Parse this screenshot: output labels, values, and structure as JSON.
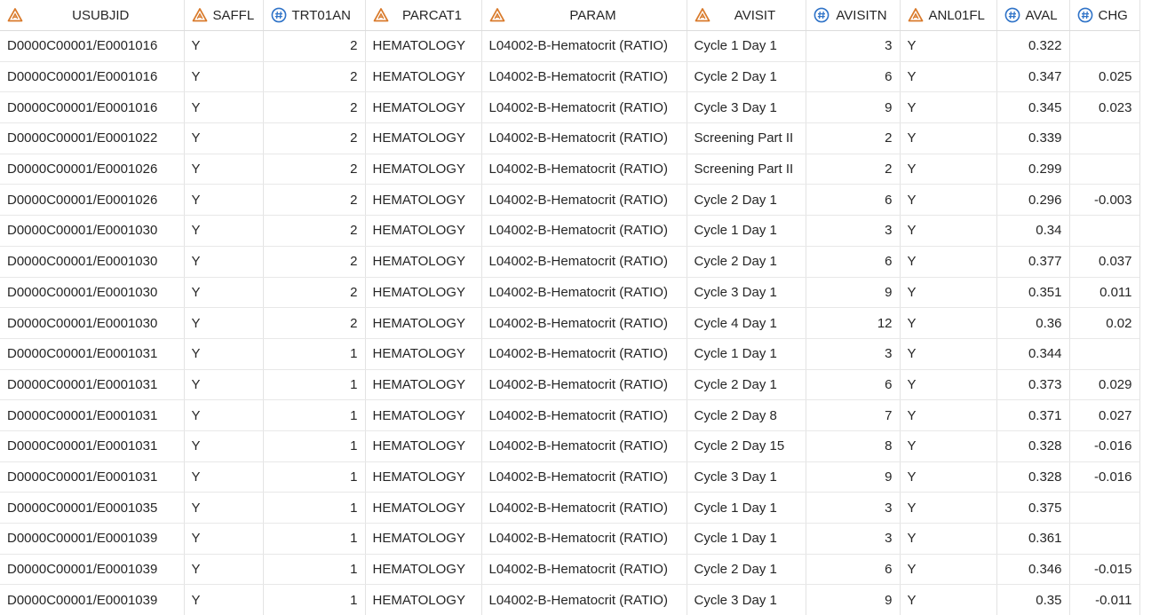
{
  "columns": [
    {
      "name": "USUBJID",
      "type": "char"
    },
    {
      "name": "SAFFL",
      "type": "char"
    },
    {
      "name": "TRT01AN",
      "type": "num"
    },
    {
      "name": "PARCAT1",
      "type": "char"
    },
    {
      "name": "PARAM",
      "type": "char"
    },
    {
      "name": "AVISIT",
      "type": "char"
    },
    {
      "name": "AVISITN",
      "type": "num"
    },
    {
      "name": "ANL01FL",
      "type": "char"
    },
    {
      "name": "AVAL",
      "type": "num"
    },
    {
      "name": "CHG",
      "type": "num"
    }
  ],
  "icons": {
    "char": "character-column-icon",
    "num": "numeric-column-icon"
  },
  "colors": {
    "char_icon": "#d97a2b",
    "num_icon": "#2f73c8",
    "grid_line": "#e3e3e3"
  },
  "rows": [
    [
      "D0000C00001/E0001016",
      "Y",
      "2",
      "HEMATOLOGY",
      "L04002-B-Hematocrit (RATIO)",
      "Cycle 1 Day 1",
      "3",
      "Y",
      "0.322",
      ""
    ],
    [
      "D0000C00001/E0001016",
      "Y",
      "2",
      "HEMATOLOGY",
      "L04002-B-Hematocrit (RATIO)",
      "Cycle 2 Day 1",
      "6",
      "Y",
      "0.347",
      "0.025"
    ],
    [
      "D0000C00001/E0001016",
      "Y",
      "2",
      "HEMATOLOGY",
      "L04002-B-Hematocrit (RATIO)",
      "Cycle 3 Day 1",
      "9",
      "Y",
      "0.345",
      "0.023"
    ],
    [
      "D0000C00001/E0001022",
      "Y",
      "2",
      "HEMATOLOGY",
      "L04002-B-Hematocrit (RATIO)",
      "Screening Part II",
      "2",
      "Y",
      "0.339",
      ""
    ],
    [
      "D0000C00001/E0001026",
      "Y",
      "2",
      "HEMATOLOGY",
      "L04002-B-Hematocrit (RATIO)",
      "Screening Part II",
      "2",
      "Y",
      "0.299",
      ""
    ],
    [
      "D0000C00001/E0001026",
      "Y",
      "2",
      "HEMATOLOGY",
      "L04002-B-Hematocrit (RATIO)",
      "Cycle 2 Day 1",
      "6",
      "Y",
      "0.296",
      "-0.003"
    ],
    [
      "D0000C00001/E0001030",
      "Y",
      "2",
      "HEMATOLOGY",
      "L04002-B-Hematocrit (RATIO)",
      "Cycle 1 Day 1",
      "3",
      "Y",
      "0.34",
      ""
    ],
    [
      "D0000C00001/E0001030",
      "Y",
      "2",
      "HEMATOLOGY",
      "L04002-B-Hematocrit (RATIO)",
      "Cycle 2 Day 1",
      "6",
      "Y",
      "0.377",
      "0.037"
    ],
    [
      "D0000C00001/E0001030",
      "Y",
      "2",
      "HEMATOLOGY",
      "L04002-B-Hematocrit (RATIO)",
      "Cycle 3 Day 1",
      "9",
      "Y",
      "0.351",
      "0.011"
    ],
    [
      "D0000C00001/E0001030",
      "Y",
      "2",
      "HEMATOLOGY",
      "L04002-B-Hematocrit (RATIO)",
      "Cycle 4 Day 1",
      "12",
      "Y",
      "0.36",
      "0.02"
    ],
    [
      "D0000C00001/E0001031",
      "Y",
      "1",
      "HEMATOLOGY",
      "L04002-B-Hematocrit (RATIO)",
      "Cycle 1 Day 1",
      "3",
      "Y",
      "0.344",
      ""
    ],
    [
      "D0000C00001/E0001031",
      "Y",
      "1",
      "HEMATOLOGY",
      "L04002-B-Hematocrit (RATIO)",
      "Cycle 2 Day 1",
      "6",
      "Y",
      "0.373",
      "0.029"
    ],
    [
      "D0000C00001/E0001031",
      "Y",
      "1",
      "HEMATOLOGY",
      "L04002-B-Hematocrit (RATIO)",
      "Cycle 2 Day 8",
      "7",
      "Y",
      "0.371",
      "0.027"
    ],
    [
      "D0000C00001/E0001031",
      "Y",
      "1",
      "HEMATOLOGY",
      "L04002-B-Hematocrit (RATIO)",
      "Cycle 2 Day 15",
      "8",
      "Y",
      "0.328",
      "-0.016"
    ],
    [
      "D0000C00001/E0001031",
      "Y",
      "1",
      "HEMATOLOGY",
      "L04002-B-Hematocrit (RATIO)",
      "Cycle 3 Day 1",
      "9",
      "Y",
      "0.328",
      "-0.016"
    ],
    [
      "D0000C00001/E0001035",
      "Y",
      "1",
      "HEMATOLOGY",
      "L04002-B-Hematocrit (RATIO)",
      "Cycle 1 Day 1",
      "3",
      "Y",
      "0.375",
      ""
    ],
    [
      "D0000C00001/E0001039",
      "Y",
      "1",
      "HEMATOLOGY",
      "L04002-B-Hematocrit (RATIO)",
      "Cycle 1 Day 1",
      "3",
      "Y",
      "0.361",
      ""
    ],
    [
      "D0000C00001/E0001039",
      "Y",
      "1",
      "HEMATOLOGY",
      "L04002-B-Hematocrit (RATIO)",
      "Cycle 2 Day 1",
      "6",
      "Y",
      "0.346",
      "-0.015"
    ],
    [
      "D0000C00001/E0001039",
      "Y",
      "1",
      "HEMATOLOGY",
      "L04002-B-Hematocrit (RATIO)",
      "Cycle 3 Day 1",
      "9",
      "Y",
      "0.35",
      "-0.011"
    ]
  ]
}
